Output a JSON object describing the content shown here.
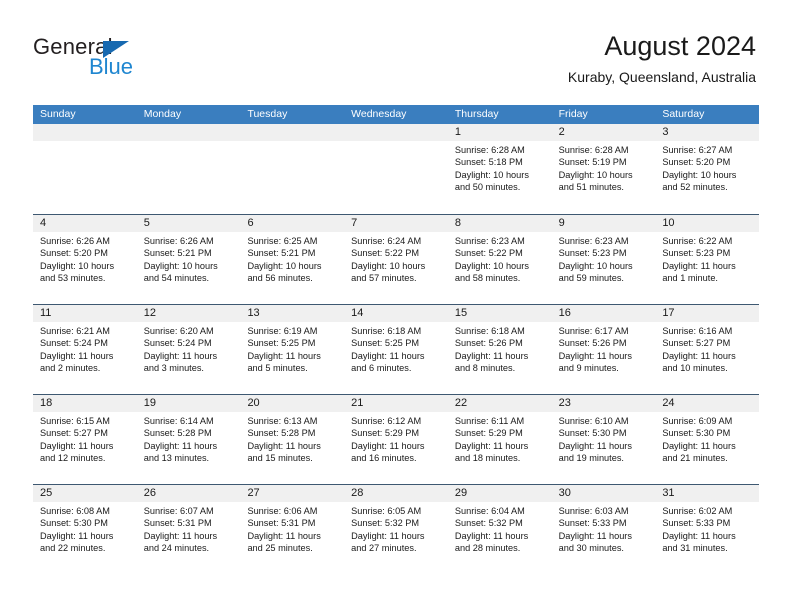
{
  "brand": {
    "name_part1": "General",
    "name_part2": "Blue",
    "triangle_color": "#1769b0",
    "blue_color": "#1f86d0"
  },
  "header": {
    "title": "August 2024",
    "subtitle": "Kuraby, Queensland, Australia"
  },
  "colors": {
    "header_bar": "#3a7ebf",
    "week_divider": "#3e5871",
    "daynum_band": "#f0f0f0",
    "text": "#1a1a1a"
  },
  "weekdays": [
    "Sunday",
    "Monday",
    "Tuesday",
    "Wednesday",
    "Thursday",
    "Friday",
    "Saturday"
  ],
  "weeks": [
    {
      "days": [
        {
          "num": "",
          "sunrise": "",
          "sunset": "",
          "daylight1": "",
          "daylight2": ""
        },
        {
          "num": "",
          "sunrise": "",
          "sunset": "",
          "daylight1": "",
          "daylight2": ""
        },
        {
          "num": "",
          "sunrise": "",
          "sunset": "",
          "daylight1": "",
          "daylight2": ""
        },
        {
          "num": "",
          "sunrise": "",
          "sunset": "",
          "daylight1": "",
          "daylight2": ""
        },
        {
          "num": "1",
          "sunrise": "Sunrise: 6:28 AM",
          "sunset": "Sunset: 5:18 PM",
          "daylight1": "Daylight: 10 hours",
          "daylight2": "and 50 minutes."
        },
        {
          "num": "2",
          "sunrise": "Sunrise: 6:28 AM",
          "sunset": "Sunset: 5:19 PM",
          "daylight1": "Daylight: 10 hours",
          "daylight2": "and 51 minutes."
        },
        {
          "num": "3",
          "sunrise": "Sunrise: 6:27 AM",
          "sunset": "Sunset: 5:20 PM",
          "daylight1": "Daylight: 10 hours",
          "daylight2": "and 52 minutes."
        }
      ]
    },
    {
      "days": [
        {
          "num": "4",
          "sunrise": "Sunrise: 6:26 AM",
          "sunset": "Sunset: 5:20 PM",
          "daylight1": "Daylight: 10 hours",
          "daylight2": "and 53 minutes."
        },
        {
          "num": "5",
          "sunrise": "Sunrise: 6:26 AM",
          "sunset": "Sunset: 5:21 PM",
          "daylight1": "Daylight: 10 hours",
          "daylight2": "and 54 minutes."
        },
        {
          "num": "6",
          "sunrise": "Sunrise: 6:25 AM",
          "sunset": "Sunset: 5:21 PM",
          "daylight1": "Daylight: 10 hours",
          "daylight2": "and 56 minutes."
        },
        {
          "num": "7",
          "sunrise": "Sunrise: 6:24 AM",
          "sunset": "Sunset: 5:22 PM",
          "daylight1": "Daylight: 10 hours",
          "daylight2": "and 57 minutes."
        },
        {
          "num": "8",
          "sunrise": "Sunrise: 6:23 AM",
          "sunset": "Sunset: 5:22 PM",
          "daylight1": "Daylight: 10 hours",
          "daylight2": "and 58 minutes."
        },
        {
          "num": "9",
          "sunrise": "Sunrise: 6:23 AM",
          "sunset": "Sunset: 5:23 PM",
          "daylight1": "Daylight: 10 hours",
          "daylight2": "and 59 minutes."
        },
        {
          "num": "10",
          "sunrise": "Sunrise: 6:22 AM",
          "sunset": "Sunset: 5:23 PM",
          "daylight1": "Daylight: 11 hours",
          "daylight2": "and 1 minute."
        }
      ]
    },
    {
      "days": [
        {
          "num": "11",
          "sunrise": "Sunrise: 6:21 AM",
          "sunset": "Sunset: 5:24 PM",
          "daylight1": "Daylight: 11 hours",
          "daylight2": "and 2 minutes."
        },
        {
          "num": "12",
          "sunrise": "Sunrise: 6:20 AM",
          "sunset": "Sunset: 5:24 PM",
          "daylight1": "Daylight: 11 hours",
          "daylight2": "and 3 minutes."
        },
        {
          "num": "13",
          "sunrise": "Sunrise: 6:19 AM",
          "sunset": "Sunset: 5:25 PM",
          "daylight1": "Daylight: 11 hours",
          "daylight2": "and 5 minutes."
        },
        {
          "num": "14",
          "sunrise": "Sunrise: 6:18 AM",
          "sunset": "Sunset: 5:25 PM",
          "daylight1": "Daylight: 11 hours",
          "daylight2": "and 6 minutes."
        },
        {
          "num": "15",
          "sunrise": "Sunrise: 6:18 AM",
          "sunset": "Sunset: 5:26 PM",
          "daylight1": "Daylight: 11 hours",
          "daylight2": "and 8 minutes."
        },
        {
          "num": "16",
          "sunrise": "Sunrise: 6:17 AM",
          "sunset": "Sunset: 5:26 PM",
          "daylight1": "Daylight: 11 hours",
          "daylight2": "and 9 minutes."
        },
        {
          "num": "17",
          "sunrise": "Sunrise: 6:16 AM",
          "sunset": "Sunset: 5:27 PM",
          "daylight1": "Daylight: 11 hours",
          "daylight2": "and 10 minutes."
        }
      ]
    },
    {
      "days": [
        {
          "num": "18",
          "sunrise": "Sunrise: 6:15 AM",
          "sunset": "Sunset: 5:27 PM",
          "daylight1": "Daylight: 11 hours",
          "daylight2": "and 12 minutes."
        },
        {
          "num": "19",
          "sunrise": "Sunrise: 6:14 AM",
          "sunset": "Sunset: 5:28 PM",
          "daylight1": "Daylight: 11 hours",
          "daylight2": "and 13 minutes."
        },
        {
          "num": "20",
          "sunrise": "Sunrise: 6:13 AM",
          "sunset": "Sunset: 5:28 PM",
          "daylight1": "Daylight: 11 hours",
          "daylight2": "and 15 minutes."
        },
        {
          "num": "21",
          "sunrise": "Sunrise: 6:12 AM",
          "sunset": "Sunset: 5:29 PM",
          "daylight1": "Daylight: 11 hours",
          "daylight2": "and 16 minutes."
        },
        {
          "num": "22",
          "sunrise": "Sunrise: 6:11 AM",
          "sunset": "Sunset: 5:29 PM",
          "daylight1": "Daylight: 11 hours",
          "daylight2": "and 18 minutes."
        },
        {
          "num": "23",
          "sunrise": "Sunrise: 6:10 AM",
          "sunset": "Sunset: 5:30 PM",
          "daylight1": "Daylight: 11 hours",
          "daylight2": "and 19 minutes."
        },
        {
          "num": "24",
          "sunrise": "Sunrise: 6:09 AM",
          "sunset": "Sunset: 5:30 PM",
          "daylight1": "Daylight: 11 hours",
          "daylight2": "and 21 minutes."
        }
      ]
    },
    {
      "days": [
        {
          "num": "25",
          "sunrise": "Sunrise: 6:08 AM",
          "sunset": "Sunset: 5:30 PM",
          "daylight1": "Daylight: 11 hours",
          "daylight2": "and 22 minutes."
        },
        {
          "num": "26",
          "sunrise": "Sunrise: 6:07 AM",
          "sunset": "Sunset: 5:31 PM",
          "daylight1": "Daylight: 11 hours",
          "daylight2": "and 24 minutes."
        },
        {
          "num": "27",
          "sunrise": "Sunrise: 6:06 AM",
          "sunset": "Sunset: 5:31 PM",
          "daylight1": "Daylight: 11 hours",
          "daylight2": "and 25 minutes."
        },
        {
          "num": "28",
          "sunrise": "Sunrise: 6:05 AM",
          "sunset": "Sunset: 5:32 PM",
          "daylight1": "Daylight: 11 hours",
          "daylight2": "and 27 minutes."
        },
        {
          "num": "29",
          "sunrise": "Sunrise: 6:04 AM",
          "sunset": "Sunset: 5:32 PM",
          "daylight1": "Daylight: 11 hours",
          "daylight2": "and 28 minutes."
        },
        {
          "num": "30",
          "sunrise": "Sunrise: 6:03 AM",
          "sunset": "Sunset: 5:33 PM",
          "daylight1": "Daylight: 11 hours",
          "daylight2": "and 30 minutes."
        },
        {
          "num": "31",
          "sunrise": "Sunrise: 6:02 AM",
          "sunset": "Sunset: 5:33 PM",
          "daylight1": "Daylight: 11 hours",
          "daylight2": "and 31 minutes."
        }
      ]
    }
  ]
}
